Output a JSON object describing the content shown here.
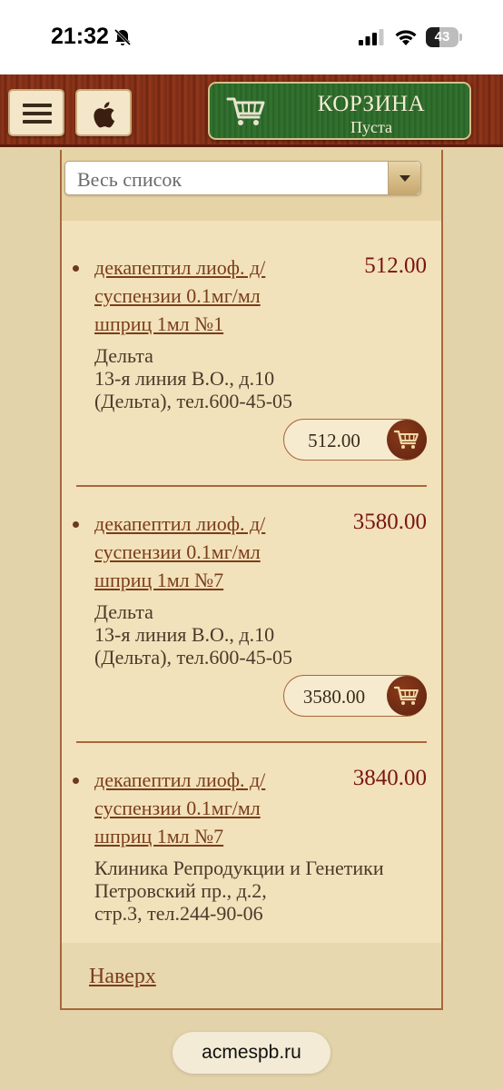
{
  "status_bar": {
    "time": "21:32",
    "battery": "43",
    "battery_level_percent": 43
  },
  "header": {
    "menu_icon": "hamburger-menu-icon",
    "apple_icon": "apple-logo-icon",
    "cart": {
      "icon": "shopping-cart-icon",
      "title": "КОРЗИНА",
      "status": "Пуста"
    }
  },
  "filter": {
    "selected": "Весь список"
  },
  "items": [
    {
      "name": "декапептил лиоф. д/ суспензии 0.1мг/мл шприц 1мл №1",
      "price": "512.00",
      "pharmacy": "Дельта\n13-я линия В.О., д.10\n(Дельта), тел.600-45-05",
      "buy_price": "512.00"
    },
    {
      "name": "декапептил лиоф. д/ суспензии 0.1мг/мл шприц 1мл №7",
      "price": "3580.00",
      "pharmacy": "Дельта\n13-я линия В.О., д.10\n(Дельта), тел.600-45-05",
      "buy_price": "3580.00"
    },
    {
      "name": "декапептил лиоф. д/ суспензии 0.1мг/мл шприц 1мл №7",
      "price": "3840.00",
      "pharmacy": "Клиника Репродукции и Генетики\nПетровский пр., д.2,\nстр.3, тел.244-90-06"
    }
  ],
  "footer": {
    "top_link": "Наверх"
  },
  "browser": {
    "url": "acmespb.ru"
  },
  "colors": {
    "header_wood": "#7a2a16",
    "cart_green": "#2e6a2d",
    "price_red": "#7a1414",
    "link_brown": "#7a3d1c",
    "page_bg": "#e3d3ab"
  }
}
